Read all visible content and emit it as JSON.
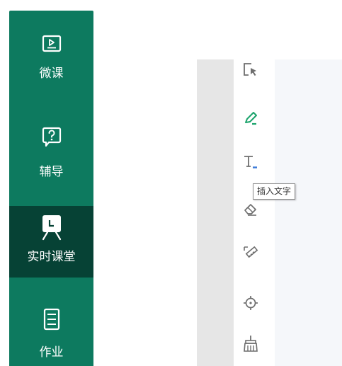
{
  "colors": {
    "sidebar_bg": "#0d7a5f",
    "sidebar_active_bg": "#064235",
    "sidebar_text": "#ffffff",
    "tool_icon": "#666666",
    "tool_active": "#1aa36b",
    "tool_accent": "#3c7ad8"
  },
  "sidebar": {
    "items": [
      {
        "label": "微课",
        "icon": "video-icon",
        "active": false
      },
      {
        "label": "辅导",
        "icon": "question-bubble-icon",
        "active": false
      },
      {
        "label": "实时课堂",
        "icon": "classroom-board-icon",
        "active": true
      },
      {
        "label": "作业",
        "icon": "homework-list-icon",
        "active": false
      }
    ]
  },
  "toolbar": {
    "tools": [
      {
        "name": "select-tool",
        "icon": "cursor-select-icon"
      },
      {
        "name": "pen-tool",
        "icon": "pen-icon",
        "active": true
      },
      {
        "name": "text-tool",
        "icon": "text-icon"
      },
      {
        "name": "eraser-tool",
        "icon": "eraser-icon"
      },
      {
        "name": "ruler-tool",
        "icon": "ruler-icon"
      },
      {
        "name": "laser-pointer-tool",
        "icon": "target-icon"
      },
      {
        "name": "clear-tool",
        "icon": "broom-icon"
      }
    ],
    "tooltip": "插入文字"
  }
}
